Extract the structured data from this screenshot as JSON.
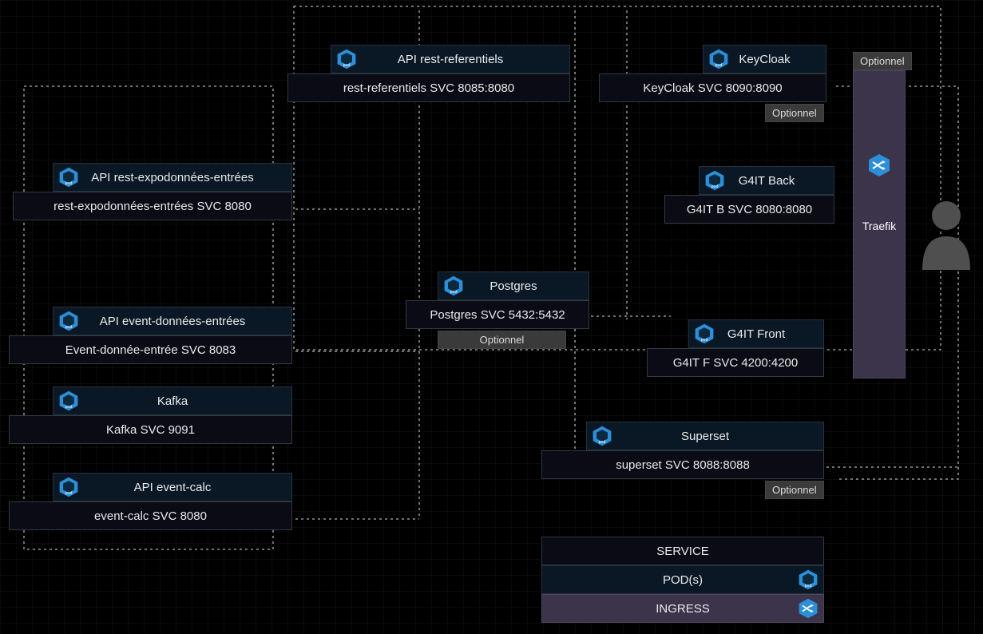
{
  "nodes": {
    "api_rest_referentiels": {
      "pod": "API rest-referentiels",
      "svc": "rest-referentiels SVC 8085:8080"
    },
    "keycloak": {
      "pod": "KeyCloak",
      "svc": "KeyCloak SVC 8090:8090",
      "tag": "Optionnel"
    },
    "api_rest_expo": {
      "pod": "API rest-expodonnées-entrées",
      "svc": "rest-expodonnées-entrées SVC 8080"
    },
    "g4it_back": {
      "pod": "G4IT Back",
      "svc": "G4IT B SVC 8080:8080"
    },
    "postgres": {
      "pod": "Postgres",
      "svc": "Postgres SVC 5432:5432",
      "tag": "Optionnel"
    },
    "g4it_front": {
      "pod": "G4IT Front",
      "svc": "G4IT F SVC 4200:4200"
    },
    "api_event_entrees": {
      "pod": "API event-données-entrées",
      "svc": "Event-donnée-entrée SVC 8083"
    },
    "kafka": {
      "pod": "Kafka",
      "svc": "Kafka SVC 9091"
    },
    "superset": {
      "pod": "Superset",
      "svc": "superset SVC 8088:8088",
      "tag": "Optionnel"
    },
    "api_event_calc": {
      "pod": "API event-calc",
      "svc": "event-calc SVC 8080"
    }
  },
  "traefik": {
    "label": "Traefik",
    "tag": "Optionnel"
  },
  "legend": {
    "service": "SERVICE",
    "pod": "POD(s)",
    "ingress": "INGRESS"
  },
  "icons": {
    "pod": "pod-icon",
    "ingress": "ingress-icon",
    "user": "user-icon"
  }
}
